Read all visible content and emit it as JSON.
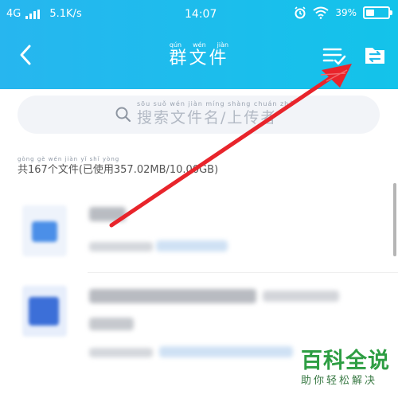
{
  "status_bar": {
    "network": "4G",
    "speed": "5.1K/s",
    "time": "14:07",
    "battery": "39%",
    "battery_level": 0.39
  },
  "navbar": {
    "title": "群文件",
    "title_pinyin": [
      "qún",
      "wén",
      "jiàn"
    ],
    "back_icon": "chevron-left-icon",
    "sort_icon": "sort-check-icon",
    "upload_icon": "upload-file-icon"
  },
  "search": {
    "placeholder": "搜索文件名/上传者",
    "placeholder_pinyin": "sōu suǒ wén jiàn míng shàng chuán zhě"
  },
  "summary": {
    "text": "共167个文件(已使用357.02MB/10.00GB)",
    "pinyin": "gòng gè wén jiàn yǐ shǐ yòng"
  },
  "watermark": {
    "title": "百科全说",
    "subtitle": "助你轻松解决"
  },
  "colors": {
    "header_start": "#27b6ef",
    "header_end": "#13c3ea",
    "arrow": "#e8242b",
    "watermark": "#2e9e43"
  }
}
